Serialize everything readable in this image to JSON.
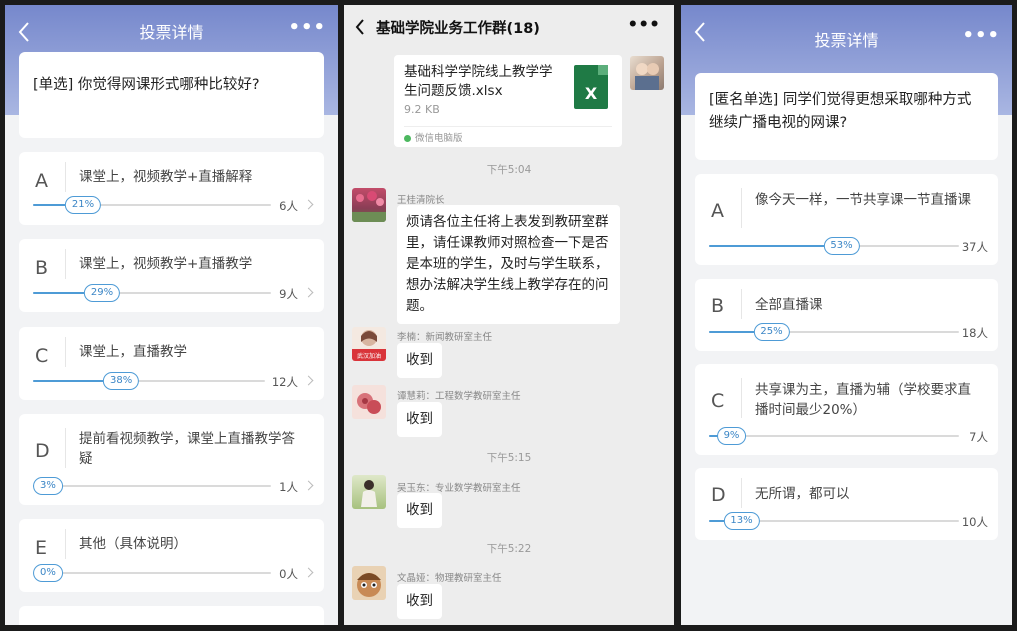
{
  "left_poll": {
    "header_title": "投票详情",
    "question": "[单选] 你觉得网课形式哪种比较好?",
    "options": [
      {
        "letter": "A",
        "text": "课堂上，视频教学+直播解释",
        "percent_label": "21%",
        "percent": 21,
        "count": "6人"
      },
      {
        "letter": "B",
        "text": "课堂上，视频教学+直播教学",
        "percent_label": "29%",
        "percent": 29,
        "count": "9人"
      },
      {
        "letter": "C",
        "text": "课堂上，直播教学",
        "percent_label": "38%",
        "percent": 38,
        "count": "12人"
      },
      {
        "letter": "D",
        "text": "提前看视频教学，课堂上直播教学答疑",
        "percent_label": "3%",
        "percent": 3,
        "count": "1人"
      },
      {
        "letter": "E",
        "text": "其他（具体说明）",
        "percent_label": "0%",
        "percent": 0,
        "count": "0人"
      }
    ]
  },
  "chat": {
    "title": "基础学院业务工作群(18)",
    "file": {
      "name": "基础科学学院线上教学学生问题反馈.xlsx",
      "size": "9.2 KB",
      "source": "微信电脑版",
      "icon_letter": "X"
    },
    "time_1": "下午5:04",
    "msg_1": {
      "sender": "王桂清院长",
      "text": "烦请各位主任将上表发到教研室群里，请任课教师对照检查一下是否是本班的学生，及时与学生联系，想办法解决学生线上教学存在的问题。"
    },
    "msg_2": {
      "sender": "李楠：新闻教研室主任",
      "text": "收到",
      "avatar_caption": "武汉加油"
    },
    "msg_3": {
      "sender": "谭慧莉：工程数学教研室主任",
      "text": "收到"
    },
    "time_2": "下午5:15",
    "msg_4": {
      "sender": "吴玉东：专业数学教研室主任",
      "text": "收到"
    },
    "time_3": "下午5:22",
    "msg_5": {
      "sender": "文晶娅：物理教研室主任",
      "text": "收到"
    }
  },
  "right_poll": {
    "header_title": "投票详情",
    "question": "[匿名单选] 同学们觉得更想采取哪种方式继续广播电视的网课?",
    "options": [
      {
        "letter": "A",
        "text": "像今天一样，一节共享课一节直播课",
        "percent_label": "53%",
        "percent": 53,
        "count": "37人"
      },
      {
        "letter": "B",
        "text": "全部直播课",
        "percent_label": "25%",
        "percent": 25,
        "count": "18人"
      },
      {
        "letter": "C",
        "text": "共享课为主，直播为辅（学校要求直播时间最少20%）",
        "percent_label": "9%",
        "percent": 9,
        "count": "7人"
      },
      {
        "letter": "D",
        "text": "无所谓，都可以",
        "percent_label": "13%",
        "percent": 13,
        "count": "10人"
      }
    ]
  },
  "colors": {
    "header_blue": "#7688cc",
    "progress_blue": "#4e9bd6",
    "excel_green": "#1f7a45"
  }
}
